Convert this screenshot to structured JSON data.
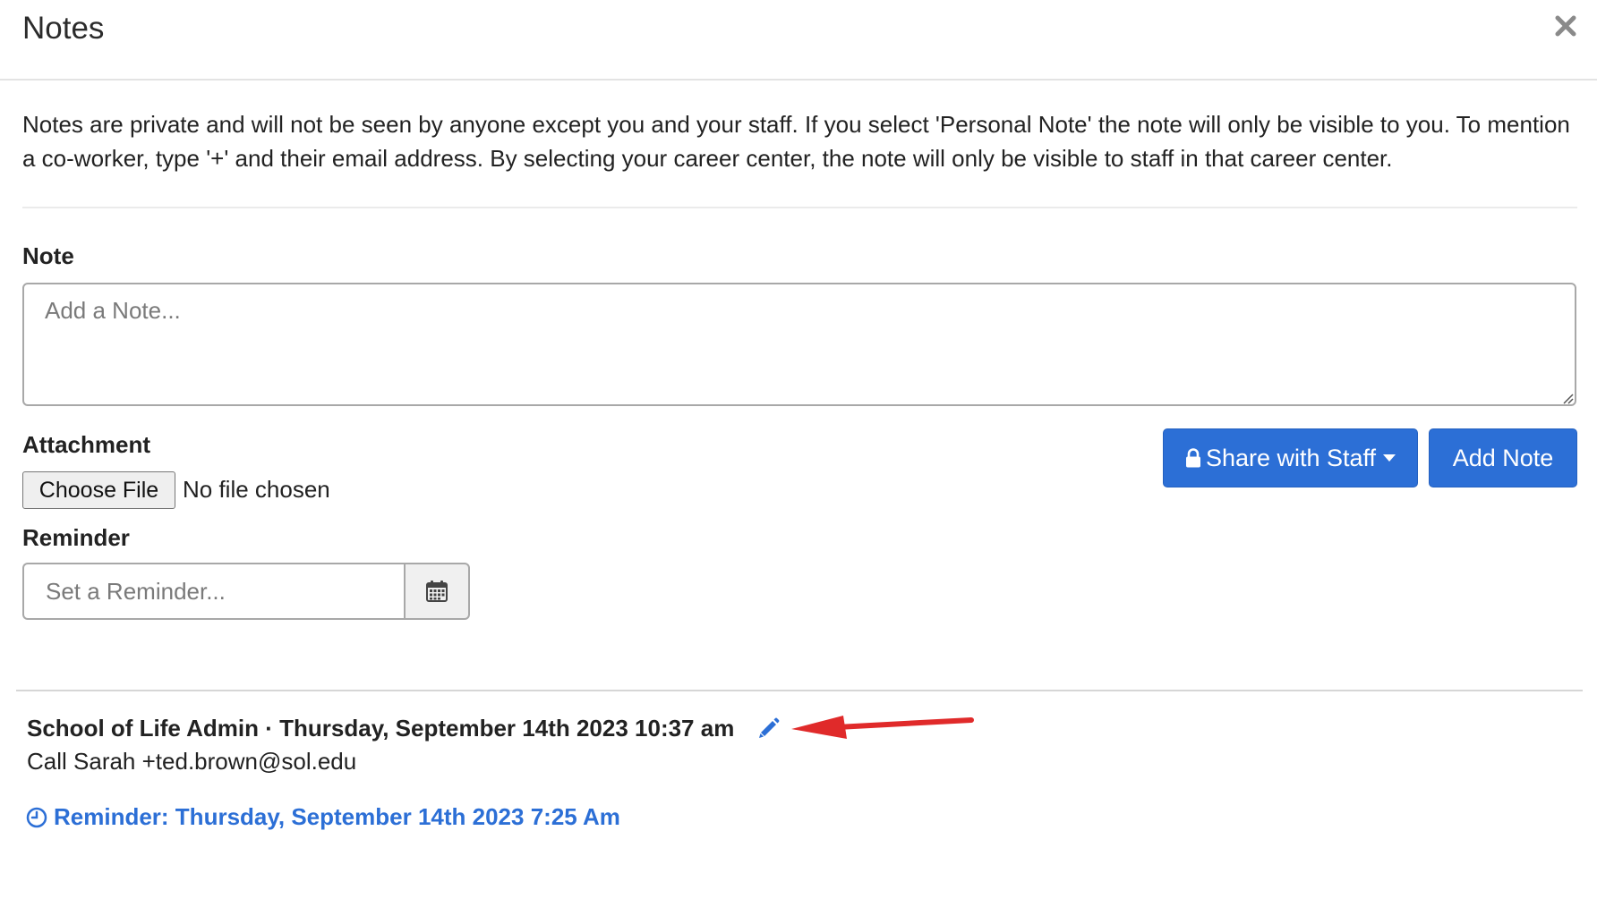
{
  "modal": {
    "title": "Notes",
    "close_icon": "close-icon"
  },
  "intro_text": "Notes are private and will not be seen by anyone except you and your staff. If you select 'Personal Note' the note will only be visible to you. To mention a co-worker, type '+' and their email address. By selecting your career center, the note will only be visible to staff in that career center.",
  "form": {
    "note_label": "Note",
    "note_placeholder": "Add a Note...",
    "attachment_label": "Attachment",
    "choose_file_label": "Choose File",
    "file_status": "No file chosen",
    "reminder_label": "Reminder",
    "reminder_placeholder": "Set a Reminder...",
    "calendar_icon": "calendar-icon"
  },
  "actions": {
    "share_label": "Share with Staff",
    "share_icon": "lock-icon",
    "add_note_label": "Add Note"
  },
  "colors": {
    "primary": "#2c6fd6",
    "annotation_arrow": "#e02a2a"
  },
  "note_entry": {
    "meta": "School of Life Admin · Thursday, September 14th 2023 10:37 am",
    "edit_icon": "pencil-icon",
    "body": "Call Sarah +ted.brown@sol.edu",
    "reminder_text": "Reminder: Thursday, September 14th 2023 7:25 Am",
    "reminder_icon": "clock-icon"
  }
}
